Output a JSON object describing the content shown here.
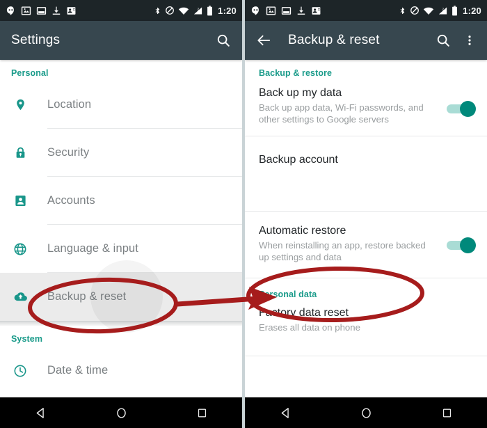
{
  "status_bar": {
    "icons": [
      "hangouts-icon",
      "photo-icon",
      "screenshot-icon",
      "download-icon",
      "contacts-sync-icon"
    ],
    "right_icons": [
      "bluetooth-icon",
      "do-not-disturb-icon",
      "wifi-icon",
      "signal-icon",
      "battery-icon"
    ],
    "clock": "1:20"
  },
  "left_panel": {
    "appbar": {
      "title": "Settings",
      "search_icon": "search-icon"
    },
    "sections": [
      {
        "header": "Personal",
        "items": [
          {
            "label": "Location",
            "icon": "location-pin-icon",
            "highlighted": false
          },
          {
            "label": "Security",
            "icon": "lock-icon",
            "highlighted": false
          },
          {
            "label": "Accounts",
            "icon": "account-badge-icon",
            "highlighted": false
          },
          {
            "label": "Language & input",
            "icon": "globe-icon",
            "highlighted": false
          },
          {
            "label": "Backup & reset",
            "icon": "cloud-upload-icon",
            "highlighted": true
          }
        ]
      },
      {
        "header": "System",
        "items": [
          {
            "label": "Date & time",
            "icon": "clock-icon",
            "highlighted": false
          }
        ]
      }
    ]
  },
  "right_panel": {
    "appbar": {
      "back_icon": "arrow-back-icon",
      "title": "Backup & reset",
      "search_icon": "search-icon",
      "overflow_icon": "more-vert-icon"
    },
    "sections": [
      {
        "header": "Backup & restore",
        "items": [
          {
            "title": "Back up my data",
            "subtitle": "Back up app data, Wi-Fi passwords, and other settings to Google servers",
            "toggle": true,
            "toggle_on": true
          },
          {
            "title": "Backup account",
            "subtitle": "",
            "toggle": false,
            "toggle_on": false
          },
          {
            "title": "Automatic restore",
            "subtitle": "When reinstalling an app, restore backed up settings and data",
            "toggle": true,
            "toggle_on": true
          }
        ]
      },
      {
        "header": "Personal data",
        "items": [
          {
            "title": "Factory data reset",
            "subtitle": "Erases all data on phone",
            "toggle": false,
            "toggle_on": false
          }
        ]
      }
    ]
  },
  "nav_bar": {
    "back": "back-triangle-icon",
    "home": "home-circle-icon",
    "recents": "recents-square-icon"
  },
  "annotations": {
    "circle_left_target": "Backup & reset",
    "circle_right_target": "Factory data reset",
    "arrow": "step-arrow",
    "color": "#a61c1c"
  },
  "colors": {
    "status_bar": "#1d2528",
    "app_bar": "#37474f",
    "accent_teal": "#1a9b8a",
    "icon_teal": "#19968a",
    "toggle_on": "#00897b",
    "annotation_red": "#a61c1c",
    "nav_bar": "#000000"
  }
}
